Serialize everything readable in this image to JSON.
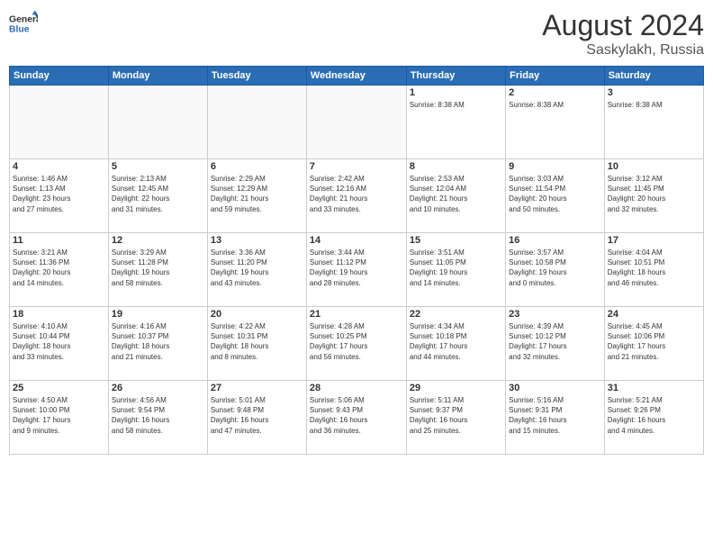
{
  "header": {
    "logo": {
      "general": "General",
      "blue": "Blue"
    },
    "title": "August 2024",
    "location": "Saskylakh, Russia"
  },
  "calendar": {
    "days_of_week": [
      "Sunday",
      "Monday",
      "Tuesday",
      "Wednesday",
      "Thursday",
      "Friday",
      "Saturday"
    ],
    "weeks": [
      [
        {
          "day": "",
          "info": ""
        },
        {
          "day": "",
          "info": ""
        },
        {
          "day": "",
          "info": ""
        },
        {
          "day": "",
          "info": ""
        },
        {
          "day": "1",
          "info": "Sunrise: 8:38 AM\n\n\n"
        },
        {
          "day": "2",
          "info": "Sunrise: 8:38 AM\n\n\n"
        },
        {
          "day": "3",
          "info": "Sunrise: 8:38 AM\n\n\n"
        }
      ],
      [
        {
          "day": "4",
          "info": "Sunrise: 1:46 AM\nSunset: 1:13 AM\nDaylight: 23 hours\nand 27 minutes."
        },
        {
          "day": "5",
          "info": "Sunrise: 2:13 AM\nSunset: 12:45 AM\nDaylight: 22 hours\nand 31 minutes."
        },
        {
          "day": "6",
          "info": "Sunrise: 2:29 AM\nSunset: 12:29 AM\nDaylight: 21 hours\nand 59 minutes."
        },
        {
          "day": "7",
          "info": "Sunrise: 2:42 AM\nSunset: 12:16 AM\nDaylight: 21 hours\nand 33 minutes."
        },
        {
          "day": "8",
          "info": "Sunrise: 2:53 AM\nSunset: 12:04 AM\nDaylight: 21 hours\nand 10 minutes."
        },
        {
          "day": "9",
          "info": "Sunrise: 3:03 AM\nSunset: 11:54 PM\nDaylight: 20 hours\nand 50 minutes."
        },
        {
          "day": "10",
          "info": "Sunrise: 3:12 AM\nSunset: 11:45 PM\nDaylight: 20 hours\nand 32 minutes."
        }
      ],
      [
        {
          "day": "11",
          "info": "Sunrise: 3:21 AM\nSunset: 11:36 PM\nDaylight: 20 hours\nand 14 minutes."
        },
        {
          "day": "12",
          "info": "Sunrise: 3:29 AM\nSunset: 11:28 PM\nDaylight: 19 hours\nand 58 minutes."
        },
        {
          "day": "13",
          "info": "Sunrise: 3:36 AM\nSunset: 11:20 PM\nDaylight: 19 hours\nand 43 minutes."
        },
        {
          "day": "14",
          "info": "Sunrise: 3:44 AM\nSunset: 11:12 PM\nDaylight: 19 hours\nand 28 minutes."
        },
        {
          "day": "15",
          "info": "Sunrise: 3:51 AM\nSunset: 11:05 PM\nDaylight: 19 hours\nand 14 minutes."
        },
        {
          "day": "16",
          "info": "Sunrise: 3:57 AM\nSunset: 10:58 PM\nDaylight: 19 hours\nand 0 minutes."
        },
        {
          "day": "17",
          "info": "Sunrise: 4:04 AM\nSunset: 10:51 PM\nDaylight: 18 hours\nand 46 minutes."
        }
      ],
      [
        {
          "day": "18",
          "info": "Sunrise: 4:10 AM\nSunset: 10:44 PM\nDaylight: 18 hours\nand 33 minutes."
        },
        {
          "day": "19",
          "info": "Sunrise: 4:16 AM\nSunset: 10:37 PM\nDaylight: 18 hours\nand 21 minutes."
        },
        {
          "day": "20",
          "info": "Sunrise: 4:22 AM\nSunset: 10:31 PM\nDaylight: 18 hours\nand 8 minutes."
        },
        {
          "day": "21",
          "info": "Sunrise: 4:28 AM\nSunset: 10:25 PM\nDaylight: 17 hours\nand 56 minutes."
        },
        {
          "day": "22",
          "info": "Sunrise: 4:34 AM\nSunset: 10:18 PM\nDaylight: 17 hours\nand 44 minutes."
        },
        {
          "day": "23",
          "info": "Sunrise: 4:39 AM\nSunset: 10:12 PM\nDaylight: 17 hours\nand 32 minutes."
        },
        {
          "day": "24",
          "info": "Sunrise: 4:45 AM\nSunset: 10:06 PM\nDaylight: 17 hours\nand 21 minutes."
        }
      ],
      [
        {
          "day": "25",
          "info": "Sunrise: 4:50 AM\nSunset: 10:00 PM\nDaylight: 17 hours\nand 9 minutes."
        },
        {
          "day": "26",
          "info": "Sunrise: 4:56 AM\nSunset: 9:54 PM\nDaylight: 16 hours\nand 58 minutes."
        },
        {
          "day": "27",
          "info": "Sunrise: 5:01 AM\nSunset: 9:48 PM\nDaylight: 16 hours\nand 47 minutes."
        },
        {
          "day": "28",
          "info": "Sunrise: 5:06 AM\nSunset: 9:43 PM\nDaylight: 16 hours\nand 36 minutes."
        },
        {
          "day": "29",
          "info": "Sunrise: 5:11 AM\nSunset: 9:37 PM\nDaylight: 16 hours\nand 25 minutes."
        },
        {
          "day": "30",
          "info": "Sunrise: 5:16 AM\nSunset: 9:31 PM\nDaylight: 16 hours\nand 15 minutes."
        },
        {
          "day": "31",
          "info": "Sunrise: 5:21 AM\nSunset: 9:26 PM\nDaylight: 16 hours\nand 4 minutes."
        }
      ]
    ]
  }
}
